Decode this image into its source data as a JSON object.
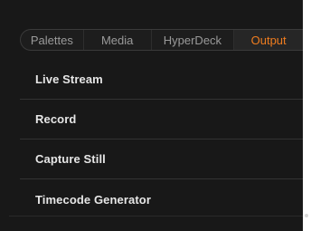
{
  "tabs": [
    {
      "label": "Palettes",
      "active": false
    },
    {
      "label": "Media",
      "active": false
    },
    {
      "label": "HyperDeck",
      "active": false
    },
    {
      "label": "Output",
      "active": true
    }
  ],
  "menu": {
    "items": [
      {
        "label": "Live Stream"
      },
      {
        "label": "Record"
      },
      {
        "label": "Capture Still"
      },
      {
        "label": "Timecode Generator"
      }
    ]
  },
  "colors": {
    "background": "#181818",
    "active_tab": "#f07d1f",
    "inactive_tab": "#9a9a9a",
    "menu_text": "#e6e6e6"
  }
}
